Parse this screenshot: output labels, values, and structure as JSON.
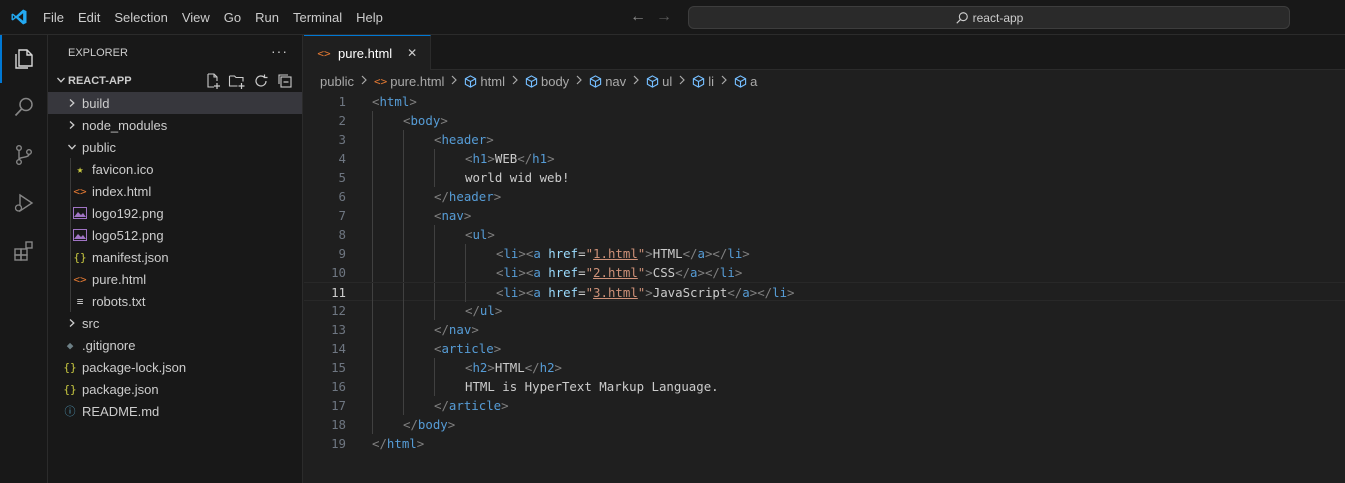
{
  "menu": [
    "File",
    "Edit",
    "Selection",
    "View",
    "Go",
    "Run",
    "Terminal",
    "Help"
  ],
  "command_center": {
    "label": "react-app"
  },
  "sidebar": {
    "title": "EXPLORER",
    "more": "···",
    "section": "REACT-APP",
    "items": [
      {
        "label": "build",
        "type": "folder",
        "expanded": false,
        "depth": 0,
        "selected": true
      },
      {
        "label": "node_modules",
        "type": "folder",
        "expanded": false,
        "depth": 0
      },
      {
        "label": "public",
        "type": "folder",
        "expanded": true,
        "depth": 0
      },
      {
        "label": "favicon.ico",
        "type": "ico",
        "depth": 1
      },
      {
        "label": "index.html",
        "type": "html",
        "depth": 1
      },
      {
        "label": "logo192.png",
        "type": "png",
        "depth": 1
      },
      {
        "label": "logo512.png",
        "type": "png",
        "depth": 1
      },
      {
        "label": "manifest.json",
        "type": "json",
        "depth": 1
      },
      {
        "label": "pure.html",
        "type": "html",
        "depth": 1
      },
      {
        "label": "robots.txt",
        "type": "txt",
        "depth": 1
      },
      {
        "label": "src",
        "type": "folder",
        "expanded": false,
        "depth": 0
      },
      {
        "label": ".gitignore",
        "type": "git",
        "depth": 0
      },
      {
        "label": "package-lock.json",
        "type": "json",
        "depth": 0
      },
      {
        "label": "package.json",
        "type": "json",
        "depth": 0
      },
      {
        "label": "README.md",
        "type": "info",
        "depth": 0
      }
    ]
  },
  "editor": {
    "tab": {
      "label": "pure.html"
    },
    "breadcrumbs": [
      "public",
      "pure.html",
      "html",
      "body",
      "nav",
      "ul",
      "li",
      "a"
    ],
    "current_line": 11,
    "lines": [
      [
        [
          "b",
          "<"
        ],
        [
          "t",
          "html"
        ],
        [
          "b",
          ">"
        ]
      ],
      [
        [
          "b",
          "<"
        ],
        [
          "t",
          "body"
        ],
        [
          "b",
          ">"
        ]
      ],
      [
        [
          "b",
          "<"
        ],
        [
          "t",
          "header"
        ],
        [
          "b",
          ">"
        ]
      ],
      [
        [
          "b",
          "<"
        ],
        [
          "t",
          "h1"
        ],
        [
          "b",
          ">"
        ],
        [
          "x",
          "WEB"
        ],
        [
          "b",
          "</"
        ],
        [
          "t",
          "h1"
        ],
        [
          "b",
          ">"
        ]
      ],
      [
        [
          "x",
          "world wid web!"
        ]
      ],
      [
        [
          "b",
          "</"
        ],
        [
          "t",
          "header"
        ],
        [
          "b",
          ">"
        ]
      ],
      [
        [
          "b",
          "<"
        ],
        [
          "t",
          "nav"
        ],
        [
          "b",
          ">"
        ]
      ],
      [
        [
          "b",
          "<"
        ],
        [
          "t",
          "ul"
        ],
        [
          "b",
          ">"
        ]
      ],
      [
        [
          "b",
          "<"
        ],
        [
          "t",
          "li"
        ],
        [
          "b",
          "><"
        ],
        [
          "t",
          "a"
        ],
        [
          "x",
          " "
        ],
        [
          "a",
          "href"
        ],
        [
          "x",
          "="
        ],
        [
          "s",
          "\""
        ],
        [
          "l",
          "1.html"
        ],
        [
          "s",
          "\""
        ],
        [
          "b",
          ">"
        ],
        [
          "x",
          "HTML"
        ],
        [
          "b",
          "</"
        ],
        [
          "t",
          "a"
        ],
        [
          "b",
          "></"
        ],
        [
          "t",
          "li"
        ],
        [
          "b",
          ">"
        ]
      ],
      [
        [
          "b",
          "<"
        ],
        [
          "t",
          "li"
        ],
        [
          "b",
          "><"
        ],
        [
          "t",
          "a"
        ],
        [
          "x",
          " "
        ],
        [
          "a",
          "href"
        ],
        [
          "x",
          "="
        ],
        [
          "s",
          "\""
        ],
        [
          "l",
          "2.html"
        ],
        [
          "s",
          "\""
        ],
        [
          "b",
          ">"
        ],
        [
          "x",
          "CSS"
        ],
        [
          "b",
          "</"
        ],
        [
          "t",
          "a"
        ],
        [
          "b",
          "></"
        ],
        [
          "t",
          "li"
        ],
        [
          "b",
          ">"
        ]
      ],
      [
        [
          "b",
          "<"
        ],
        [
          "t",
          "li"
        ],
        [
          "b",
          "><"
        ],
        [
          "t",
          "a"
        ],
        [
          "x",
          " "
        ],
        [
          "a",
          "href"
        ],
        [
          "x",
          "="
        ],
        [
          "s",
          "\""
        ],
        [
          "l",
          "3.html"
        ],
        [
          "s",
          "\""
        ],
        [
          "b",
          ">"
        ],
        [
          "x",
          "JavaScript"
        ],
        [
          "b",
          "</"
        ],
        [
          "t",
          "a"
        ],
        [
          "b",
          "></"
        ],
        [
          "t",
          "li"
        ],
        [
          "b",
          ">"
        ]
      ],
      [
        [
          "b",
          "</"
        ],
        [
          "t",
          "ul"
        ],
        [
          "b",
          ">"
        ]
      ],
      [
        [
          "b",
          "</"
        ],
        [
          "t",
          "nav"
        ],
        [
          "b",
          ">"
        ]
      ],
      [
        [
          "b",
          "<"
        ],
        [
          "t",
          "article"
        ],
        [
          "b",
          ">"
        ]
      ],
      [
        [
          "b",
          "<"
        ],
        [
          "t",
          "h2"
        ],
        [
          "b",
          ">"
        ],
        [
          "x",
          "HTML"
        ],
        [
          "b",
          "</"
        ],
        [
          "t",
          "h2"
        ],
        [
          "b",
          ">"
        ]
      ],
      [
        [
          "x",
          "HTML is HyperText Markup Language."
        ]
      ],
      [
        [
          "b",
          "</"
        ],
        [
          "t",
          "article"
        ],
        [
          "b",
          ">"
        ]
      ],
      [
        [
          "b",
          "</"
        ],
        [
          "t",
          "body"
        ],
        [
          "b",
          ">"
        ]
      ],
      [
        [
          "b",
          "</"
        ],
        [
          "t",
          "html"
        ],
        [
          "b",
          ">"
        ]
      ]
    ],
    "indents": [
      0,
      1,
      2,
      3,
      3,
      2,
      2,
      3,
      4,
      4,
      4,
      3,
      2,
      2,
      3,
      3,
      2,
      1,
      0
    ]
  },
  "colors": {
    "accent": "#0078d4",
    "tag": "#569cd6",
    "attribute": "#9cdcfe",
    "string": "#ce9178",
    "bracket": "#808080"
  }
}
